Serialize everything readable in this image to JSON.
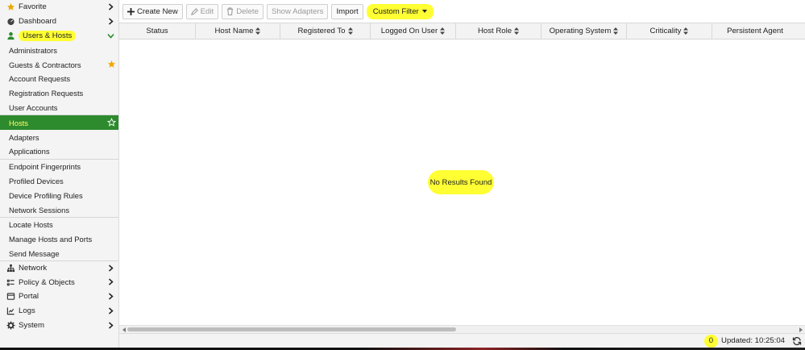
{
  "sidebar": {
    "top_items": [
      {
        "label": "Favorite",
        "icon": "star-icon"
      },
      {
        "label": "Dashboard",
        "icon": "dashboard-icon"
      }
    ],
    "users_hosts": {
      "label": "Users & Hosts",
      "icon": "user-icon"
    },
    "group1": [
      "Administrators",
      "Guests & Contractors",
      "Account Requests",
      "Registration Requests",
      "User Accounts"
    ],
    "group2": [
      "Hosts",
      "Adapters",
      "Applications"
    ],
    "group3": [
      "Endpoint Fingerprints",
      "Profiled Devices",
      "Device Profiling Rules",
      "Network Sessions"
    ],
    "group4": [
      "Locate Hosts",
      "Manage Hosts and Ports",
      "Send Message"
    ],
    "bottom_items": [
      {
        "label": "Network",
        "icon": "network-icon"
      },
      {
        "label": "Policy & Objects",
        "icon": "policy-icon"
      },
      {
        "label": "Portal",
        "icon": "portal-icon"
      },
      {
        "label": "Logs",
        "icon": "logs-icon"
      },
      {
        "label": "System",
        "icon": "gear-icon"
      }
    ]
  },
  "toolbar": {
    "create_new": "Create New",
    "edit": "Edit",
    "delete": "Delete",
    "show_adapters": "Show Adapters",
    "import": "Import",
    "custom_filter": "Custom Filter"
  },
  "table": {
    "columns": [
      "Status",
      "Host Name",
      "Registered To",
      "Logged On User",
      "Host Role",
      "Operating System",
      "Criticality",
      "Persistent Agent"
    ],
    "empty_message": "No Results Found"
  },
  "footer": {
    "count": "0",
    "updated": "Updated: 10:25:04"
  },
  "colors": {
    "active_bg": "#2d8a2d",
    "active_text": "#ffff66",
    "highlight": "#ffff33",
    "star": "#f0a800"
  }
}
